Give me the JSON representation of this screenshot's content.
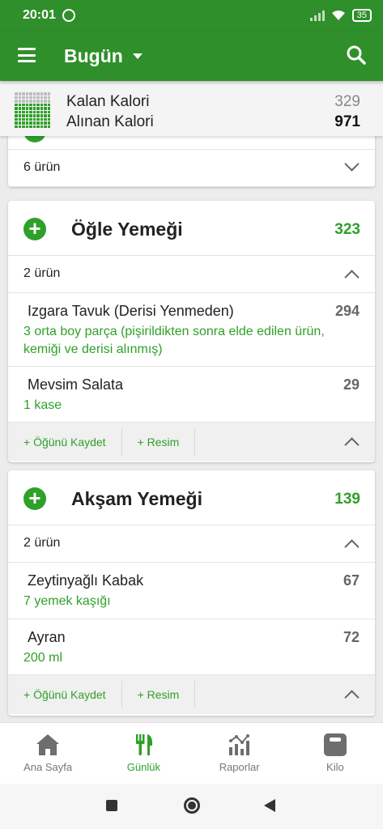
{
  "status_bar": {
    "time": "20:01",
    "battery": "35"
  },
  "app_bar": {
    "title": "Bugün"
  },
  "summary": {
    "remaining_label": "Kalan Kalori",
    "remaining_value": "329",
    "consumed_label": "Alınan Kalori",
    "consumed_value": "971"
  },
  "prev_meal": {
    "count": "6 ürün"
  },
  "meals": [
    {
      "name": "Öğle Yemeği",
      "calories": "323",
      "count": "2 ürün",
      "items": [
        {
          "name": "Izgara Tavuk (Derisi Yenmeden)",
          "calories": "294",
          "portion": "3  orta boy parça (pişirildikten sonra elde edilen ürün, kemiği ve derisi alınmış)"
        },
        {
          "name": "Mevsim Salata",
          "calories": "29",
          "portion": "1  kase"
        }
      ],
      "save_label": "+ Öğünü Kaydet",
      "photo_label": "+ Resim"
    },
    {
      "name": "Akşam Yemeği",
      "calories": "139",
      "count": "2 ürün",
      "items": [
        {
          "name": "Zeytinyağlı Kabak",
          "calories": "67",
          "portion": "7  yemek kaşığı"
        },
        {
          "name": "Ayran",
          "calories": "72",
          "portion": "200  ml"
        }
      ],
      "save_label": "+ Öğünü Kaydet",
      "photo_label": "+ Resim"
    }
  ],
  "bottom_nav": [
    {
      "label": "Ana Sayfa",
      "icon": "home-icon"
    },
    {
      "label": "Günlük",
      "icon": "fork-knife-icon"
    },
    {
      "label": "Raporlar",
      "icon": "chart-icon"
    },
    {
      "label": "Kilo",
      "icon": "scale-icon"
    }
  ],
  "colors": {
    "primary": "#2f8f2a",
    "accent": "#2fa02a"
  }
}
